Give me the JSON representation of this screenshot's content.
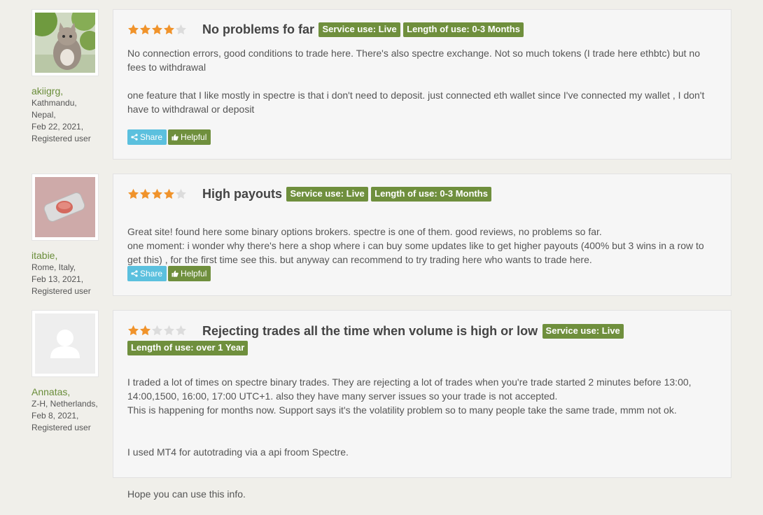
{
  "colors": {
    "star_filled": "#f0932b",
    "star_empty": "#dcdcdc",
    "tag_bg": "#6f8f3d",
    "share_bg": "#5bc0de",
    "helpful_bg": "#6f8f3d",
    "username": "#6a8d3a"
  },
  "reviews": [
    {
      "user": {
        "name": "akiigrg,",
        "line1": "Kathmandu,",
        "line2": "Nepal,",
        "date": "Feb 22, 2021,",
        "status": "Registered user"
      },
      "rating": 4,
      "title": "No problems fo far",
      "service_tag": "Service use: Live",
      "length_tag": "Length of use: 0-3 Months",
      "paragraphs": [
        "No connection errors, good conditions to trade here. There's also spectre exchange. Not so much tokens (I trade here ethbtc) but no fees to withdrawal",
        "one feature that I like mostly in spectre is that i don't need to deposit. just connected eth wallet since I've connected my wallet , I don't have to withdrawal or deposit"
      ],
      "share_label": "Share",
      "helpful_label": "Helpful"
    },
    {
      "user": {
        "name": "itabie,",
        "line1": "Rome, Italy,",
        "line2": "Feb 13, 2021,",
        "date": "Registered user",
        "status": ""
      },
      "rating": 4,
      "title": "High payouts",
      "service_tag": "Service use: Live",
      "length_tag": "Length of use: 0-3 Months",
      "paragraphs": [
        "Great site! found here some binary options brokers. spectre is one of them. good reviews, no problems so far.\none moment: i wonder why there's here a shop where i can buy some updates like to get higher payouts (400% but 3 wins in a row to get this) , for the first time see this. but anyway can recommend to try trading here who wants to trade here."
      ],
      "share_label": "Share",
      "helpful_label": "Helpful"
    },
    {
      "user": {
        "name": "Annatas,",
        "line1": "Z-H, Netherlands,",
        "line2": "Feb 8, 2021,",
        "date": "Registered user",
        "status": ""
      },
      "rating": 2,
      "title": "Rejecting trades all the time when volume is high or low",
      "service_tag": "Service use: Live",
      "length_tag": "Length of use: over 1 Year",
      "paragraphs": [
        "I traded a lot of times on spectre binary trades. They are rejecting a lot of trades when you're trade started 2 minutes before 13:00, 14:00,1500, 16:00, 17:00 UTC+1. also they have many server issues so your trade is not accepted.\nThis is happening for months now. Support says it's the volatility problem so to many people take the same trade, mmm not ok.",
        "I used MT4 for autotrading via a api froom Spectre.",
        "Hope you can use this info."
      ]
    }
  ]
}
